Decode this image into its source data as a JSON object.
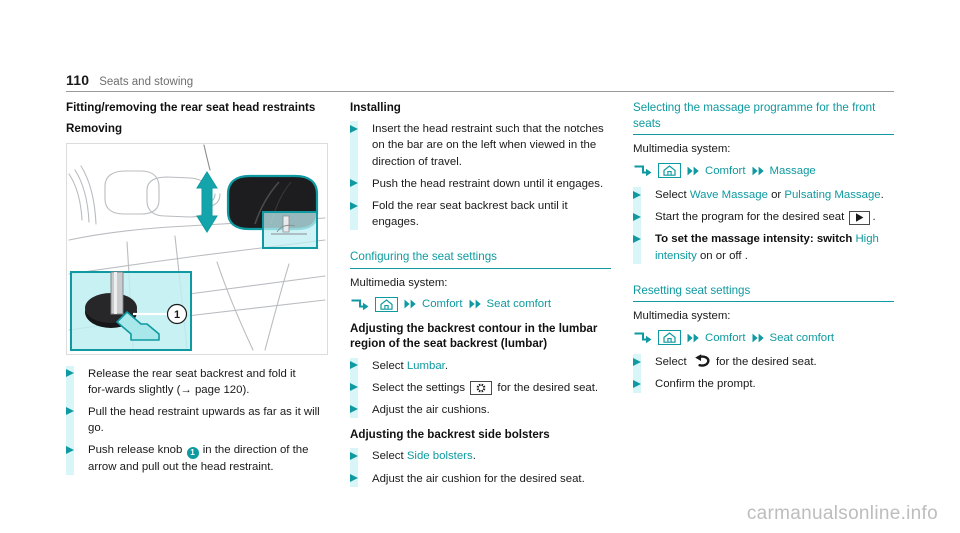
{
  "header": {
    "page_number": "110",
    "chapter": "Seats and stowing"
  },
  "watermark": "carmanualsonline.info",
  "colors": {
    "accent_teal": "#0e9aa0",
    "bullet_band": "#d8f6f8",
    "rule_gray": "#9a9a9a",
    "text_black": "#1a1a1a"
  },
  "left_column": {
    "title": "Fitting/removing the rear seat head restraints",
    "subtitle": "Removing",
    "figure": {
      "name": "rear-seat-head-restraint-removal-diagram",
      "callout_label": "1"
    },
    "steps": [
      {
        "parts": [
          {
            "text": "Release the rear seat backrest and fold it for‑wards slightly (→ page 120).",
            "style": "plain"
          }
        ]
      },
      {
        "parts": [
          {
            "text": "Pull the head restraint upwards as far as it will go.",
            "style": "plain"
          }
        ]
      },
      {
        "parts": [
          {
            "text": "Push release knob ",
            "style": "plain"
          },
          {
            "text": "1",
            "style": "callout-number"
          },
          {
            "text": " in the direction of the arrow and pull out the head restraint.",
            "style": "plain"
          }
        ]
      }
    ]
  },
  "middle_column": {
    "installing": {
      "title": "Installing",
      "steps": [
        {
          "parts": [
            {
              "text": "Insert the head restraint such that the notches on the bar are on the left when viewed in the direction of travel.",
              "style": "plain"
            }
          ]
        },
        {
          "parts": [
            {
              "text": "Push the head restraint down until it engages.",
              "style": "plain"
            }
          ]
        },
        {
          "parts": [
            {
              "text": "Fold the rear seat backrest back until it engages.",
              "style": "plain"
            }
          ]
        }
      ]
    },
    "configuring": {
      "title": "Configuring the seat settings",
      "multimedia_label": "Multimedia system:",
      "path": [
        {
          "icon": "enter-arrow-icon"
        },
        {
          "icon": "home-icon"
        },
        {
          "icon": "double-arrow-icon",
          "label": "Comfort"
        },
        {
          "icon": "double-arrow-icon",
          "label": "Seat comfort"
        }
      ],
      "lumbar_heading": "Adjusting the backrest contour in the lumbar region of the seat backrest (lumbar)",
      "lumbar_steps": [
        {
          "parts": [
            {
              "text": "Select ",
              "style": "plain"
            },
            {
              "text": "Lumbar",
              "style": "teal"
            },
            {
              "text": ".",
              "style": "plain"
            }
          ]
        },
        {
          "parts": [
            {
              "text": "Select the settings ",
              "style": "plain"
            },
            {
              "text": "settings-knob-icon",
              "style": "boxed-icon"
            },
            {
              "text": " for the desired seat.",
              "style": "plain"
            }
          ]
        },
        {
          "parts": [
            {
              "text": "Adjust the air cushions.",
              "style": "plain"
            }
          ]
        }
      ],
      "bolsters_heading": "Adjusting the backrest side bolsters",
      "bolsters_steps": [
        {
          "parts": [
            {
              "text": "Select ",
              "style": "plain"
            },
            {
              "text": "Side bolsters",
              "style": "teal"
            },
            {
              "text": ".",
              "style": "plain"
            }
          ]
        },
        {
          "parts": [
            {
              "text": "Adjust the air cushion for the desired seat.",
              "style": "plain"
            }
          ]
        }
      ]
    }
  },
  "right_column": {
    "massage": {
      "title": "Selecting the massage programme for the front seats",
      "multimedia_label": "Multimedia system:",
      "path": [
        {
          "icon": "enter-arrow-icon"
        },
        {
          "icon": "home-icon"
        },
        {
          "icon": "double-arrow-icon",
          "label": "Comfort"
        },
        {
          "icon": "double-arrow-icon",
          "label": "Massage"
        }
      ],
      "steps": [
        {
          "parts": [
            {
              "text": "Select ",
              "style": "plain"
            },
            {
              "text": "Wave Massage",
              "style": "teal"
            },
            {
              "text": " or ",
              "style": "plain"
            },
            {
              "text": "Pulsating Massage",
              "style": "teal"
            },
            {
              "text": ".",
              "style": "plain"
            }
          ]
        },
        {
          "parts": [
            {
              "text": "Start the program for the desired seat ",
              "style": "plain"
            },
            {
              "text": "play-icon",
              "style": "boxed-icon"
            },
            {
              "text": ".",
              "style": "plain"
            }
          ]
        },
        {
          "parts": [
            {
              "text": "To set the massage intensity: switch ",
              "style": "bold"
            },
            {
              "text": "High intensity",
              "style": "teal"
            },
            {
              "text": " on or off .",
              "style": "plain"
            }
          ]
        }
      ]
    },
    "resetting": {
      "title": "Resetting seat settings",
      "multimedia_label": "Multimedia system:",
      "path": [
        {
          "icon": "enter-arrow-icon"
        },
        {
          "icon": "home-icon"
        },
        {
          "icon": "double-arrow-icon",
          "label": "Comfort"
        },
        {
          "icon": "double-arrow-icon",
          "label": "Seat comfort"
        }
      ],
      "steps": [
        {
          "parts": [
            {
              "text": "Select ",
              "style": "plain"
            },
            {
              "text": "undo-arrow-icon",
              "style": "inline-icon"
            },
            {
              "text": " for the desired seat.",
              "style": "plain"
            }
          ]
        },
        {
          "parts": [
            {
              "text": "Confirm the prompt.",
              "style": "plain"
            }
          ]
        }
      ]
    }
  }
}
